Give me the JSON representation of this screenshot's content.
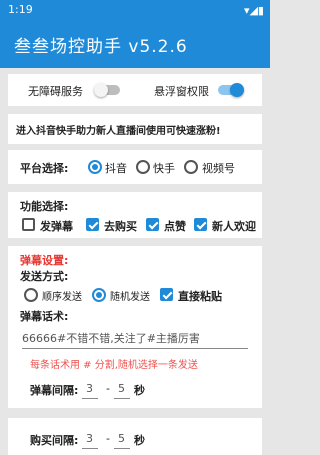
{
  "status": {
    "time": "1:19",
    "icons": "▾◢▮"
  },
  "app": {
    "title": "叁叁场控助手 v5.2.6"
  },
  "permissions": {
    "accessibility_label": "无障碍服务",
    "overlay_label": "悬浮窗权限",
    "accessibility_on": false,
    "overlay_on": true
  },
  "notice": {
    "text": "进入抖音快手助力新人直播间使用可快速涨粉!"
  },
  "platform": {
    "label": "平台选择:",
    "options": [
      "抖音",
      "快手",
      "视频号"
    ],
    "selected": "抖音"
  },
  "features": {
    "label": "功能选择:",
    "items": [
      {
        "label": "发弹幕",
        "checked": false
      },
      {
        "label": "去购买",
        "checked": true
      },
      {
        "label": "点赞",
        "checked": true
      },
      {
        "label": "新人欢迎",
        "checked": true
      }
    ]
  },
  "danmu": {
    "section_title": "弹幕设置:",
    "send_mode_label": "发送方式:",
    "modes": [
      "顺序发送",
      "随机发送"
    ],
    "selected_mode": "随机发送",
    "paste_label": "直接粘贴",
    "paste_checked": true,
    "script_label": "弹幕话术:",
    "script_value": "66666#不错不错,关注了#主播厉害",
    "hint": "每条话术用 # 分割,随机选择一条发送",
    "interval_label": "弹幕间隔:",
    "interval_min": "3",
    "interval_dash": "-",
    "interval_max": "5",
    "interval_unit": "秒"
  },
  "purchase": {
    "interval_label": "购买间隔:",
    "interval_min": "3",
    "interval_dash": "-",
    "interval_max": "5",
    "interval_unit": "秒"
  },
  "colors": {
    "primary": "#1f8ad8",
    "danger": "#e53935",
    "hint": "#ef5350"
  }
}
